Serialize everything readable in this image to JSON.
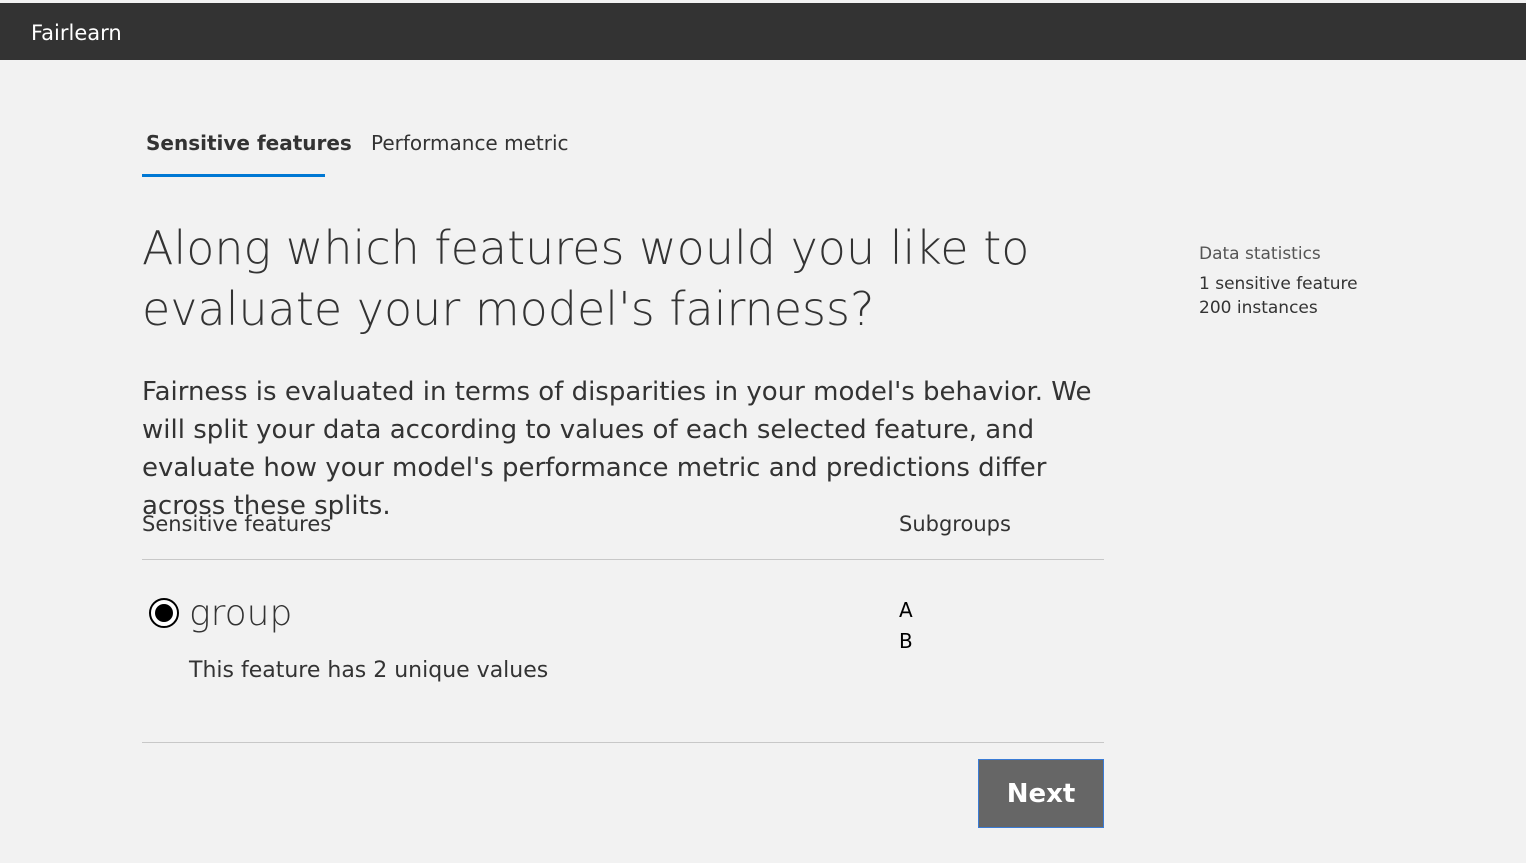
{
  "app": {
    "title": "Fairlearn"
  },
  "tabs": [
    {
      "label": "Sensitive features",
      "selected": true
    },
    {
      "label": "Performance metric",
      "selected": false
    }
  ],
  "main": {
    "headline": "Along which features would you like to evaluate your model's fairness?",
    "description": "Fairness is evaluated in terms of disparities in your model's behavior. We will split your data according to values of each selected feature, and evaluate how your model's performance metric and predictions differ across these splits.",
    "columns": {
      "features": "Sensitive features",
      "subgroups": "Subgroups"
    },
    "features": [
      {
        "name": "group",
        "description": "This feature has 2 unique values",
        "selected": true,
        "subgroups": [
          "A",
          "B"
        ]
      }
    ],
    "next_label": "Next"
  },
  "stats": {
    "title": "Data statistics",
    "lines": [
      "1 sensitive feature",
      "200 instances"
    ]
  },
  "colors": {
    "topbar": "#333333",
    "accent": "#0078d4",
    "button": "#666666",
    "background": "#f2f2f2"
  }
}
